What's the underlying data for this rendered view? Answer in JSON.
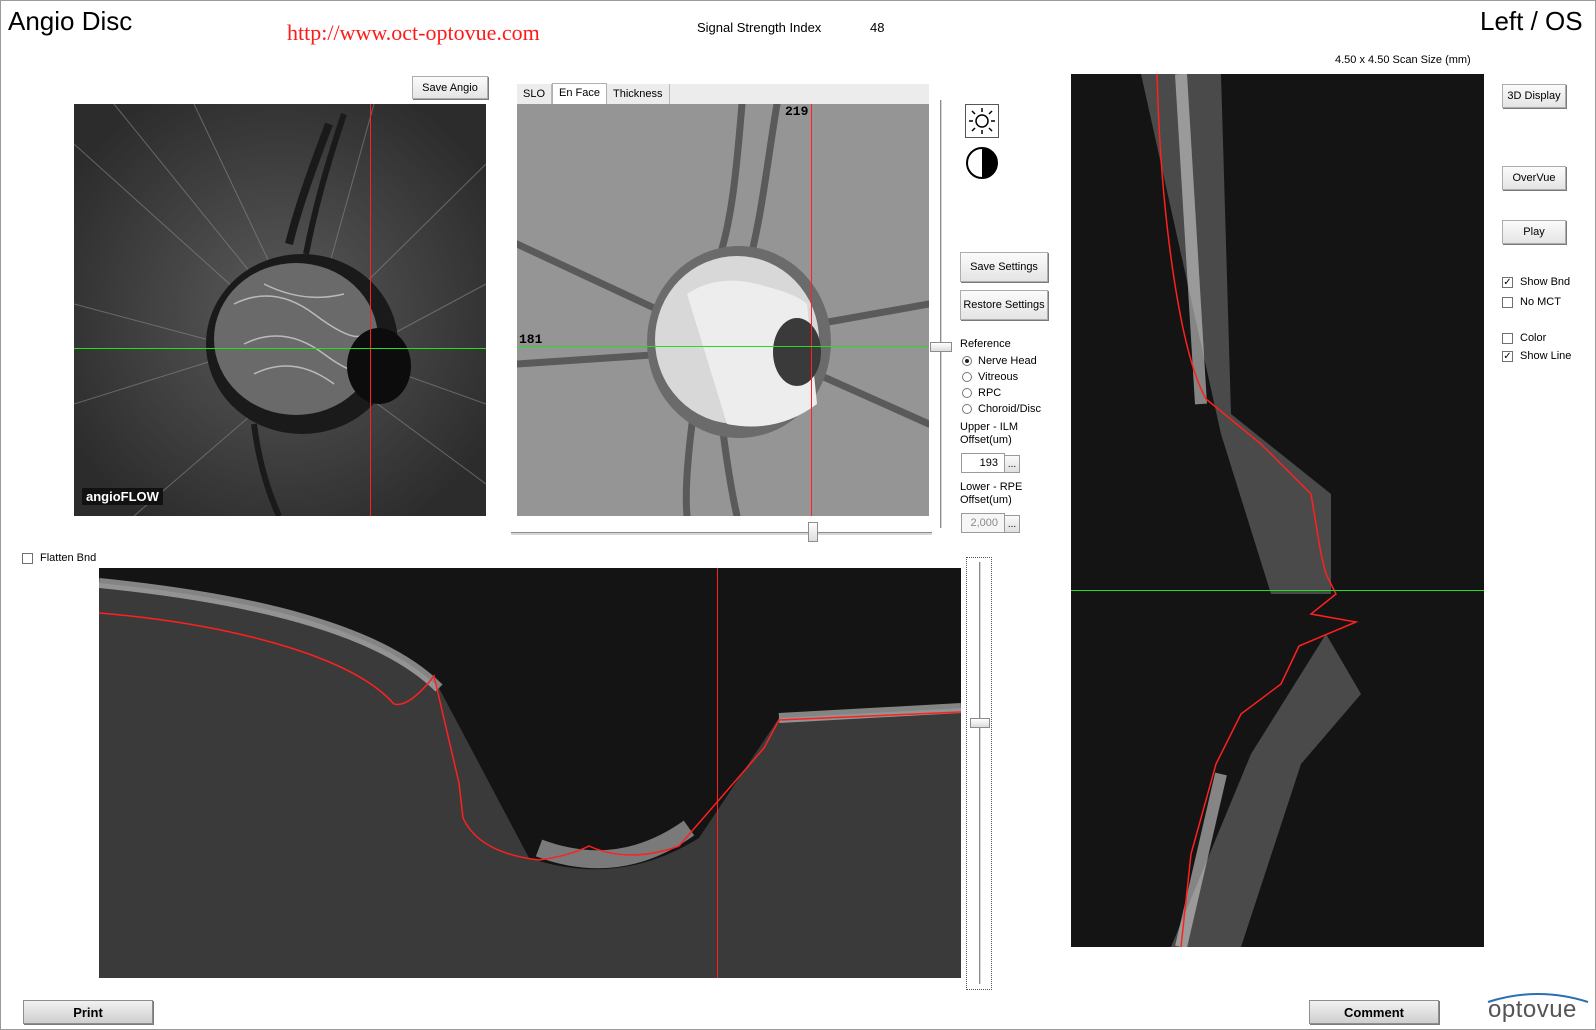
{
  "header": {
    "title": "Angio Disc",
    "url": "http://www.oct-optovue.com",
    "signal_label": "Signal Strength Index",
    "signal_value": "48",
    "eye": "Left / OS",
    "scan_size": "4.50 x 4.50 Scan Size (mm)"
  },
  "angio": {
    "save_label": "Save Angio",
    "brand": "angioFLOW"
  },
  "enface": {
    "tabs": [
      "SLO",
      "En Face",
      "Thickness"
    ],
    "active_tab": "En Face",
    "col_marker": "219",
    "row_marker": "181"
  },
  "controls": {
    "save_settings": "Save Settings",
    "restore_settings": "Restore Settings",
    "reference_label": "Reference",
    "references": [
      "Nerve Head",
      "Vitreous",
      "RPC",
      "Choroid/Disc"
    ],
    "selected_reference": "Nerve Head",
    "upper_label": "Upper - ILM",
    "upper_offset_label": "Offset(um)",
    "upper_value": "193",
    "lower_label": "Lower - RPE",
    "lower_offset_label": "Offset(um)",
    "lower_value": "2,000",
    "browse_label": "..."
  },
  "bscan": {
    "flatten_label": "Flatten Bnd",
    "flatten_checked": false
  },
  "right_panel": {
    "display_3d": "3D Display",
    "overvue": "OverVue",
    "play": "Play",
    "show_bnd": "Show Bnd",
    "no_mct": "No MCT",
    "color": "Color",
    "show_line": "Show Line",
    "show_bnd_checked": true,
    "no_mct_checked": false,
    "color_checked": false,
    "show_line_checked": true
  },
  "footer": {
    "print": "Print",
    "comment": "Comment",
    "logo": "optovue"
  },
  "colors": {
    "crosshair_vertical": "#ff2020",
    "crosshair_horizontal": "#22dd22",
    "boundary_line": "#ff2020",
    "url_text": "#ff1a1a"
  }
}
